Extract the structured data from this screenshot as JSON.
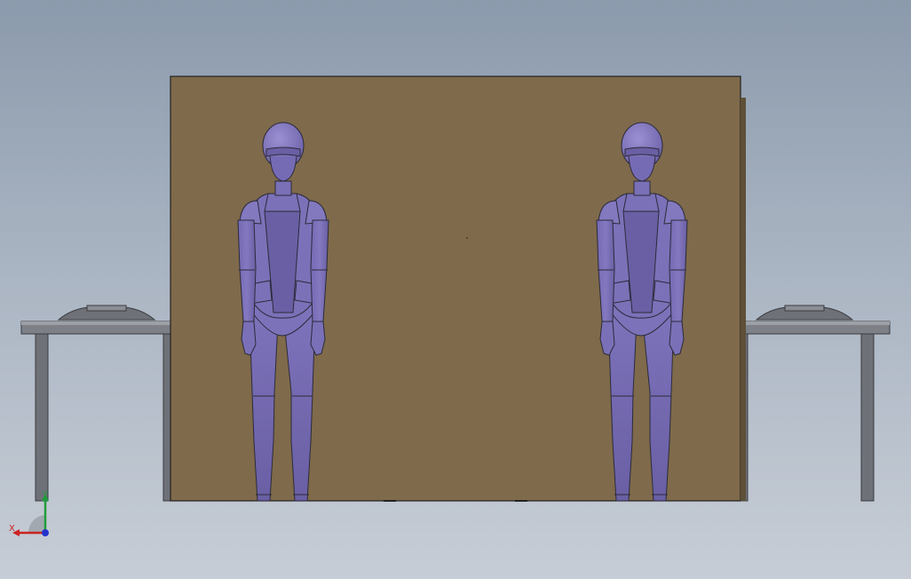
{
  "scene": {
    "objects": [
      {
        "id": "human-left",
        "kind": "human figure"
      },
      {
        "id": "human-right",
        "kind": "human figure"
      },
      {
        "id": "wall-panel",
        "kind": "back wall"
      },
      {
        "id": "table-left",
        "kind": "table"
      },
      {
        "id": "table-right",
        "kind": "table"
      }
    ],
    "colors": {
      "wall": "#7f6a4b",
      "figure": "#6d62a8",
      "figure_light": "#8479c0",
      "table": "#6e7177",
      "background_top": "#8b9aac",
      "background_bottom": "#c7cdd6"
    }
  },
  "triad": {
    "x_label": "X",
    "y_label": "Y",
    "x_color": "#cc2222",
    "y_color": "#1f9d3a",
    "z_color": "#2233cc"
  }
}
